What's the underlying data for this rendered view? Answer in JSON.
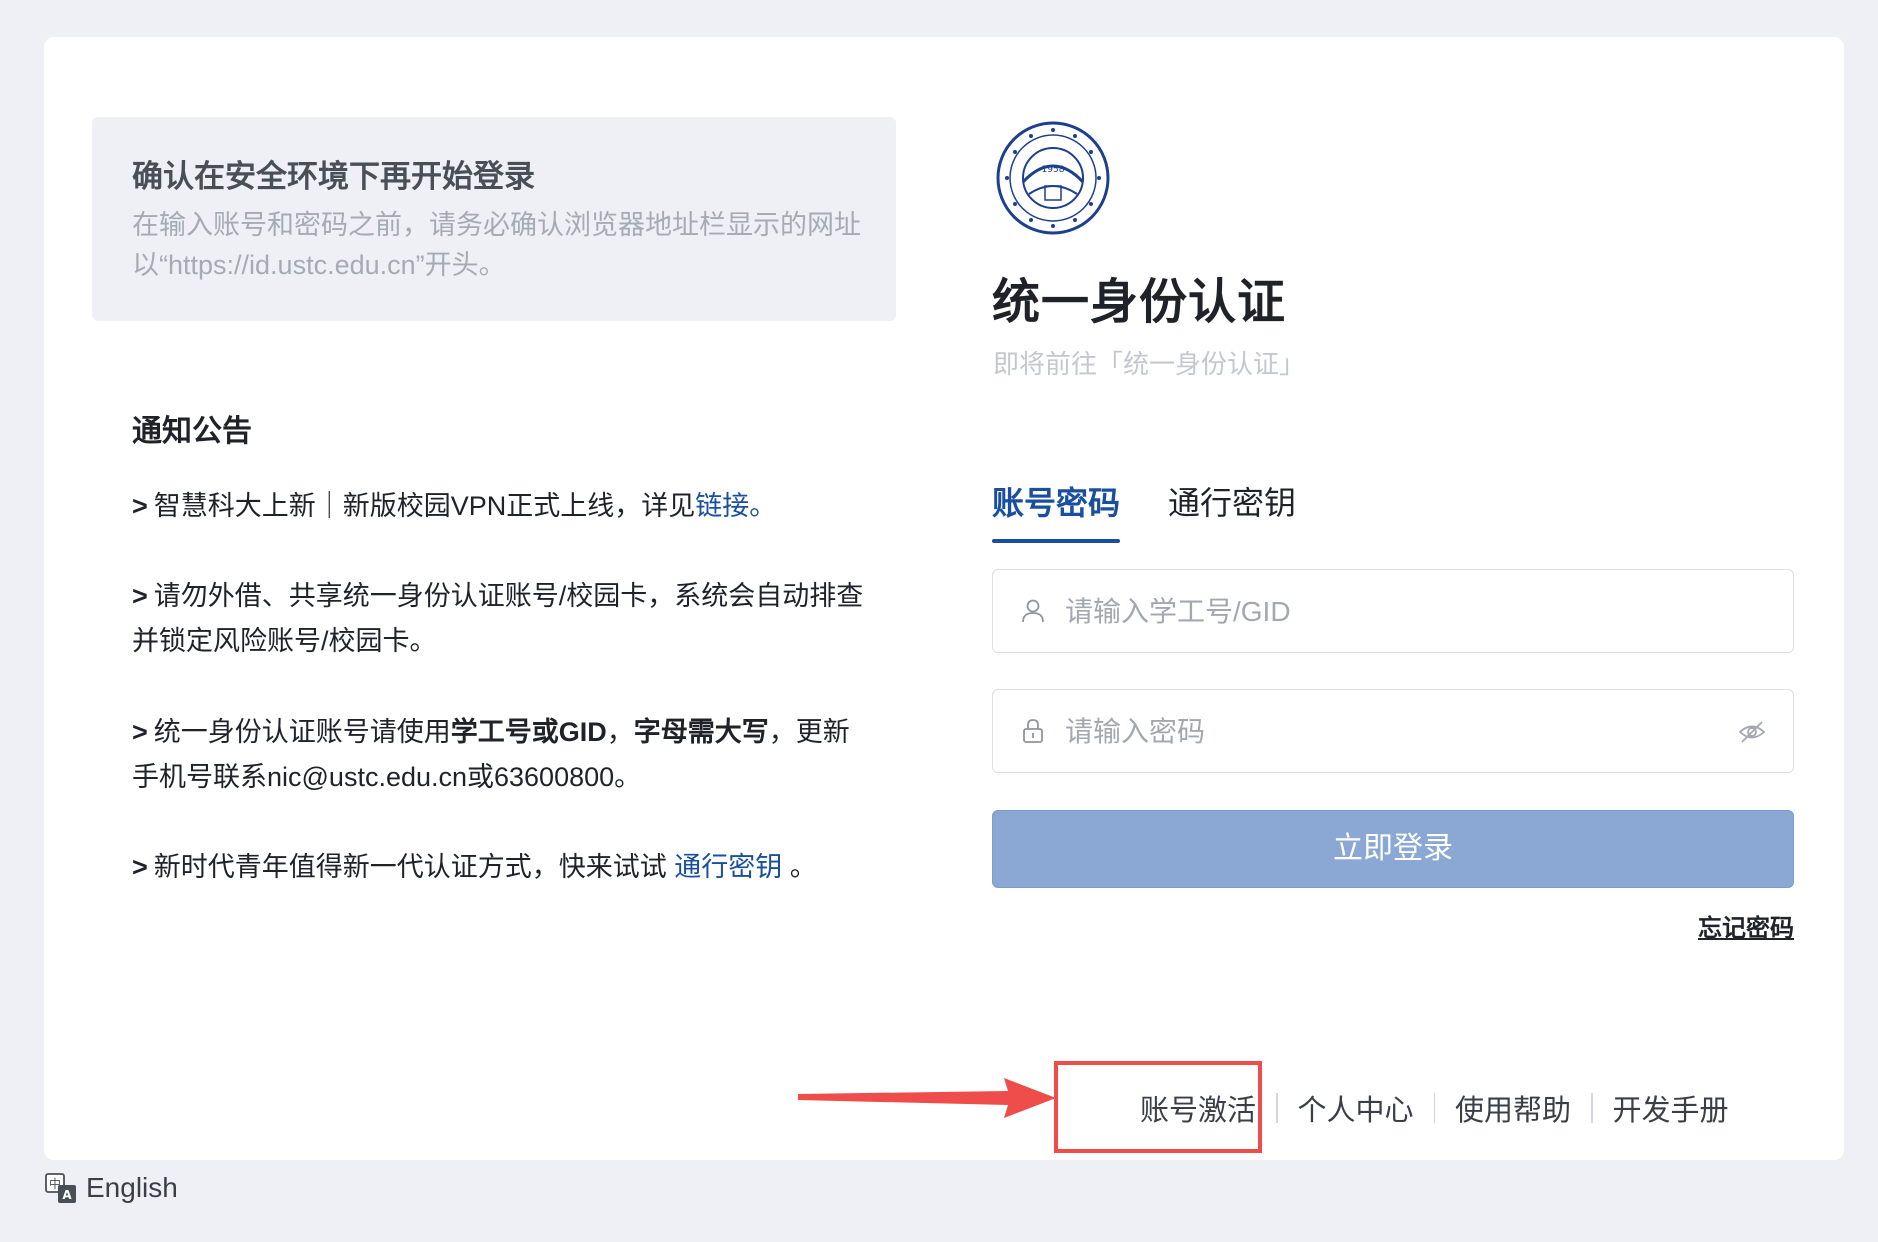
{
  "safety": {
    "title": "确认在安全环境下再开始登录",
    "text": "在输入账号和密码之前，请务必确认浏览器地址栏显示的网址以“https://id.ustc.edu.cn”开头。"
  },
  "notice": {
    "title": "通知公告",
    "items": [
      {
        "prefix": ">",
        "text": "智慧科大上新｜新版校园VPN正式上线，详见",
        "link": "链接。"
      },
      {
        "prefix": ">",
        "text": "请勿外借、共享统一身份认证账号/校园卡，系统会自动排查并锁定风险账号/校园卡。"
      },
      {
        "prefix": ">",
        "text_before": "统一身份认证账号请使用",
        "bold1": "学工号或GID",
        "comma": "，",
        "bold2": "字母需大写",
        "text_after": "，更新手机号联系nic@ustc.edu.cn或63600800。"
      },
      {
        "prefix": ">",
        "text": "新时代青年值得新一代认证方式，快来试试 ",
        "link": "通行密钥",
        "suffix": " 。"
      }
    ]
  },
  "login": {
    "title": "统一身份认证",
    "subtitle": "即将前往「统一身份认证」",
    "tabs": [
      {
        "label": "账号密码",
        "active": true
      },
      {
        "label": "通行密钥",
        "active": false
      }
    ],
    "username_placeholder": "请输入学工号/GID",
    "password_placeholder": "请输入密码",
    "submit_label": "立即登录",
    "forgot_label": "忘记密码"
  },
  "footer": {
    "links": [
      "账号激活",
      "个人中心",
      "使用帮助",
      "开发手册"
    ]
  },
  "language": {
    "label": "English",
    "icon": "translate-icon"
  },
  "logo": {
    "year": "1958",
    "icon": "university-seal"
  },
  "colors": {
    "accent": "#1a4fa0",
    "button": "#8aa8d3",
    "annotation": "#ef4c4c",
    "background": "#eef0f5"
  }
}
